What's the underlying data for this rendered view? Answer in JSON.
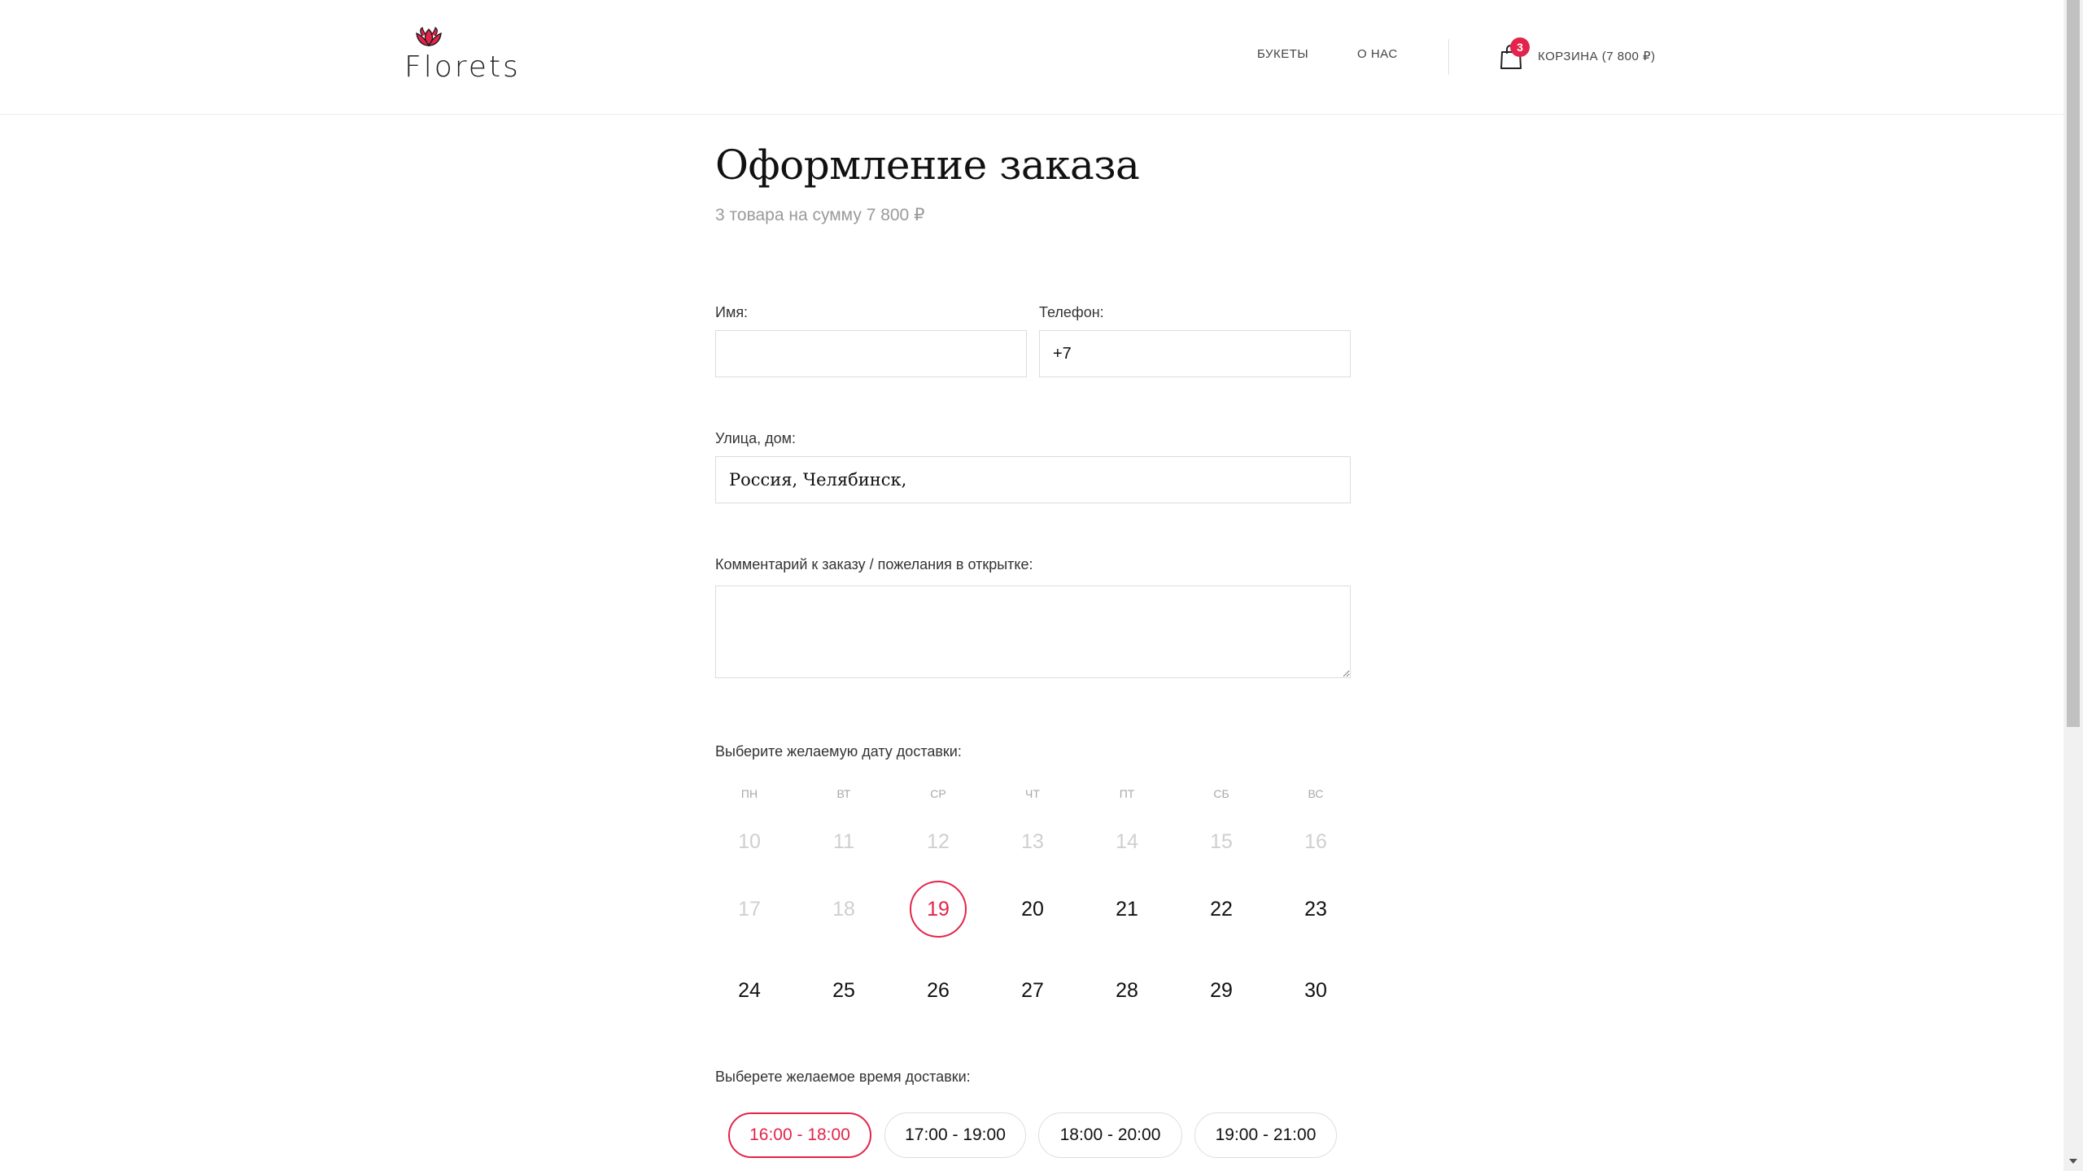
{
  "header": {
    "logo_text": "Florets",
    "nav": [
      {
        "label": "БУКЕТЫ"
      },
      {
        "label": "О НАС"
      }
    ],
    "cart": {
      "badge": "3",
      "label": "КОРЗИНА (7 800 ₽)"
    }
  },
  "page": {
    "title": "Оформление заказа",
    "subtitle": "3 товара на сумму 7 800 ₽"
  },
  "form": {
    "name_label": "Имя:",
    "name_value": "",
    "phone_label": "Телефон:",
    "phone_value": "+7",
    "street_label": "Улица, дом:",
    "street_value": "Россия, Челябинск,",
    "comment_label": "Комментарий к заказу / пожелания в открытке:",
    "comment_value": ""
  },
  "calendar": {
    "label": "Выберите желаемую дату доставки:",
    "weekdays": [
      "ПН",
      "ВТ",
      "СР",
      "ЧТ",
      "ПТ",
      "СБ",
      "ВС"
    ],
    "weeks": [
      [
        "10",
        "11",
        "12",
        "13",
        "14",
        "15",
        "16"
      ],
      [
        "17",
        "18",
        "19",
        "20",
        "21",
        "22",
        "23"
      ],
      [
        "24",
        "25",
        "26",
        "27",
        "28",
        "29",
        "30"
      ]
    ],
    "selected": "19",
    "disabled": [
      "10",
      "11",
      "12",
      "13",
      "14",
      "15",
      "16",
      "17",
      "18"
    ]
  },
  "time": {
    "label": "Выберете желаемое время доставки:",
    "slots": [
      "16:00 - 18:00",
      "17:00 - 19:00",
      "18:00 - 20:00",
      "19:00 - 21:00"
    ],
    "selected": "16:00 - 18:00"
  },
  "colors": {
    "accent": "#e4234a",
    "text": "#222222",
    "muted": "#9a9a9a",
    "border": "#dcdcdc"
  }
}
